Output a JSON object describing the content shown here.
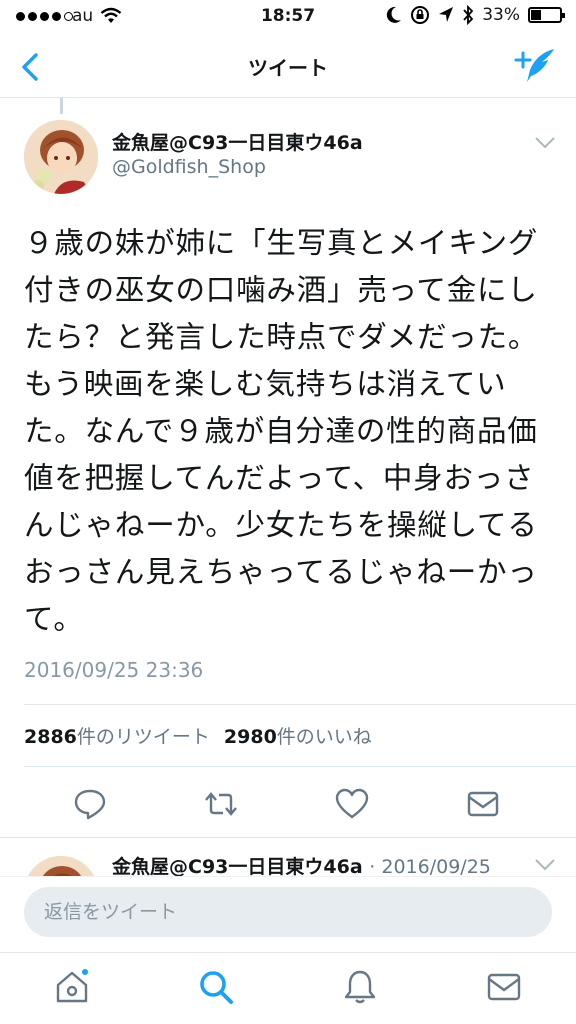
{
  "status_bar": {
    "carrier": "au",
    "time": "18:57",
    "battery": "33%",
    "battery_level": 0.33
  },
  "nav": {
    "title": "ツイート"
  },
  "tweet": {
    "display_name": "金魚屋@C93一日目東ウ46a",
    "handle": "@Goldfish_Shop",
    "text": "９歳の妹が姉に「生写真とメイキング付きの巫女の口噛み酒」売って金にしたら？と発言した時点でダメだった。もう映画を楽しむ気持ちは消えていた。なんで９歳が自分達の性的商品価値を把握してんだよって、中身おっさんじゃねーか。少女たちを操縦してるおっさん見えちゃってるじゃねーかって。",
    "timestamp": "2016/09/25 23:36",
    "retweet_count": "2886",
    "retweet_label": "件のリツイート",
    "like_count": "2980",
    "like_label": "件のいいね"
  },
  "preview_tweet": {
    "display_name": "金魚屋@C93一日目東ウ46a",
    "date": "· 2016/09/25"
  },
  "reply": {
    "placeholder": "返信をツイート"
  },
  "colors": {
    "accent": "#1da1f2",
    "action_gray": "#657786"
  },
  "icons": [
    "back-icon",
    "compose-icon",
    "reply-icon",
    "retweet-icon",
    "like-icon",
    "dm-icon",
    "home-icon",
    "search-icon",
    "notifications-icon",
    "messages-icon"
  ]
}
